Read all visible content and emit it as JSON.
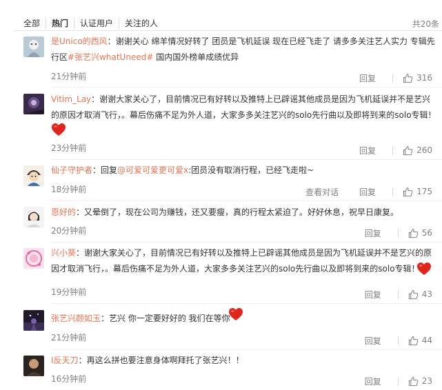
{
  "filter_bar": {
    "tabs": [
      {
        "label": "全部"
      },
      {
        "label": "热门"
      },
      {
        "label": "认证用户"
      },
      {
        "label": "关注的人"
      }
    ],
    "total_count": "共20条"
  },
  "comments": [
    {
      "username": "是Unico的西风",
      "separator": "：",
      "text_a": "谢谢关心 绵羊情况好转了 团员是飞机延误 现在已经飞走了 请多多关注艺人实力 专辑先行区",
      "hashtag": "#张艺兴whatUneed#",
      "text_b": " 国内国外榜单成绩优异",
      "time": "21分钟前",
      "reply_label": "回复",
      "likes": "316"
    },
    {
      "username": "Vitim_Lay",
      "separator": "：",
      "text_a": "谢谢大家关心了，目前情况已有好转以及推特上已辟谣其他成员是因为飞机延误并不是艺兴的原因才取消飞行，。幕后伤痛不足为外人道，大家多多关注艺兴的solo先行曲以及即将到来的solo专辑！",
      "time": "23分钟前",
      "reply_label": "回复",
      "likes": "260"
    },
    {
      "username": "仙子守护者",
      "separator": "：回复",
      "mention": "@可爱可爱更可爱x",
      "text_a": ":团员没有取消行程，已经飞走啦~",
      "time": "18分钟前",
      "view_dialog_label": "查看对话",
      "reply_label": "回复",
      "likes": "175"
    },
    {
      "username": "恩好的",
      "separator": "：",
      "text_a": "又晕倒了，现在公司为赚钱，还又要瘦，真的行程太紧迫了。好好休息，祝早日康复。",
      "time": "20分钟前",
      "reply_label": "回复",
      "likes": "56"
    },
    {
      "username": "兴小葵",
      "separator": "：",
      "text_a": "谢谢大家关心了，目前情况已有好转以及推特上已辟谣其他成员是因为飞机延误并不是艺兴的原因才取消飞行，。幕后伤痛不足为外人道，大家多多关注艺兴的solo先行曲以及即将到来的solo专辑！",
      "time": "19分钟前",
      "reply_label": "回复",
      "likes": "43"
    },
    {
      "username": "张艺兴颜如玉",
      "separator": "：",
      "text_a": "艺兴 你一定要好好的 我们在等你",
      "time": "21分钟前",
      "reply_label": "回复",
      "likes": "44"
    },
    {
      "username": "I反天刀",
      "separator": "：",
      "text_a": "再这么拼也要注意身体啊拜托了张艺兴！！",
      "time": "16分钟前",
      "reply_label": "回复",
      "likes": "23"
    }
  ],
  "colors": {
    "link_orange": "#eb7350",
    "muted_gray": "#808080",
    "heart_red": "#e0251a"
  },
  "icons": {
    "like": "thumbs-up-icon",
    "heart": "red-heart-emoji"
  }
}
